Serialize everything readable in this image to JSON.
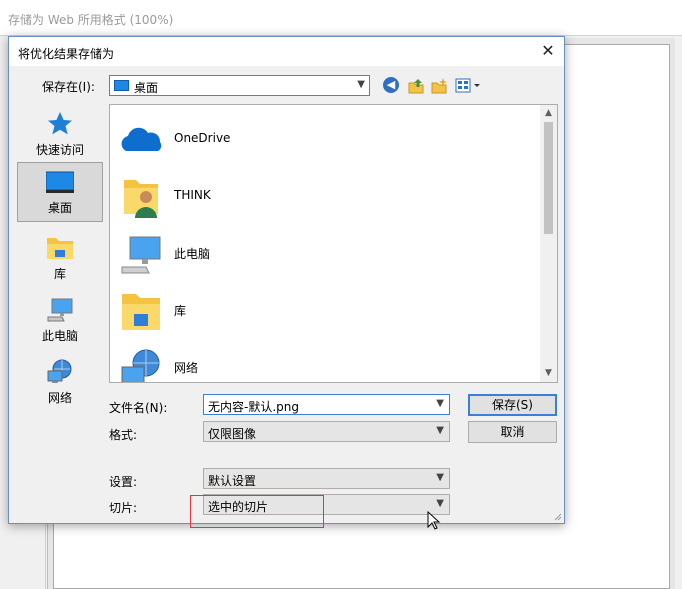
{
  "background_window": {
    "title": "存储为 Web 所用格式 (100%)"
  },
  "dialog": {
    "title": "将优化结果存储为",
    "close_glyph": "✕",
    "save_in_label": "保存在(I):",
    "save_in_value": "桌面",
    "places": [
      {
        "label": "快速访问",
        "icon": "star-icon"
      },
      {
        "label": "桌面",
        "icon": "desktop-icon",
        "selected": true
      },
      {
        "label": "库",
        "icon": "library-folder-icon"
      },
      {
        "label": "此电脑",
        "icon": "computer-icon"
      },
      {
        "label": "网络",
        "icon": "network-icon"
      }
    ],
    "files": [
      {
        "name": "OneDrive",
        "icon": "onedrive-cloud-icon"
      },
      {
        "name": "THINK",
        "icon": "user-folder-icon"
      },
      {
        "name": "此电脑",
        "icon": "computer-icon"
      },
      {
        "name": "库",
        "icon": "library-folder-icon"
      },
      {
        "name": "网络",
        "icon": "network-icon"
      }
    ],
    "filename_label": "文件名(N):",
    "filename_value": "无内容-默认.png",
    "format_label": "格式:",
    "format_value": "仅限图像",
    "settings_label": "设置:",
    "settings_value": "默认设置",
    "slices_label": "切片:",
    "slices_value": "选中的切片",
    "save_button": "保存(S)",
    "cancel_button": "取消"
  },
  "colors": {
    "accent": "#3c7fd6",
    "highlight_box": "#e0363c",
    "folder_yellow": "#f5c342",
    "desktop_blue": "#1e88e5"
  }
}
